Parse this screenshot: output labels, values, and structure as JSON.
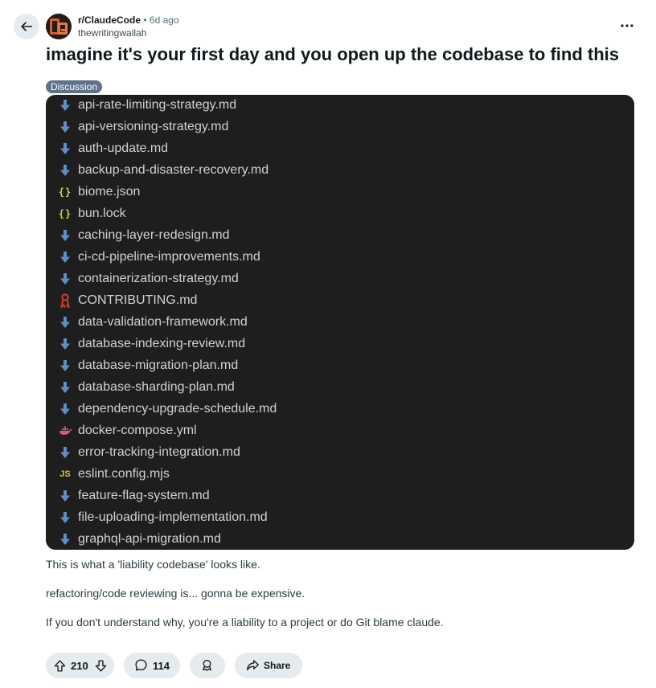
{
  "post": {
    "subreddit": "r/ClaudeCode",
    "separator": "•",
    "time_ago": "6d ago",
    "author": "thewritingwallah",
    "title": "imagine it's your first day and you open up the codebase to find this",
    "flair": "Discussion",
    "files": [
      {
        "name": "api-rate-limiting-strategy.md",
        "icon": "markdown-arrow-icon"
      },
      {
        "name": "api-versioning-strategy.md",
        "icon": "markdown-arrow-icon"
      },
      {
        "name": "auth-update.md",
        "icon": "markdown-arrow-icon"
      },
      {
        "name": "backup-and-disaster-recovery.md",
        "icon": "markdown-arrow-icon"
      },
      {
        "name": "biome.json",
        "icon": "json-braces-icon"
      },
      {
        "name": "bun.lock",
        "icon": "json-braces-icon"
      },
      {
        "name": "caching-layer-redesign.md",
        "icon": "markdown-arrow-icon"
      },
      {
        "name": "ci-cd-pipeline-improvements.md",
        "icon": "markdown-arrow-icon"
      },
      {
        "name": "containerization-strategy.md",
        "icon": "markdown-arrow-icon"
      },
      {
        "name": "CONTRIBUTING.md",
        "icon": "contributing-ribbon-icon"
      },
      {
        "name": "data-validation-framework.md",
        "icon": "markdown-arrow-icon"
      },
      {
        "name": "database-indexing-review.md",
        "icon": "markdown-arrow-icon"
      },
      {
        "name": "database-migration-plan.md",
        "icon": "markdown-arrow-icon"
      },
      {
        "name": "database-sharding-plan.md",
        "icon": "markdown-arrow-icon"
      },
      {
        "name": "dependency-upgrade-schedule.md",
        "icon": "markdown-arrow-icon"
      },
      {
        "name": "docker-compose.yml",
        "icon": "docker-whale-icon"
      },
      {
        "name": "error-tracking-integration.md",
        "icon": "markdown-arrow-icon"
      },
      {
        "name": "eslint.config.mjs",
        "icon": "js-file-icon"
      },
      {
        "name": "feature-flag-system.md",
        "icon": "markdown-arrow-icon"
      },
      {
        "name": "file-uploading-implementation.md",
        "icon": "markdown-arrow-icon"
      },
      {
        "name": "graphql-api-migration.md",
        "icon": "markdown-arrow-icon"
      }
    ],
    "body": [
      "This is what a 'liability codebase' looks like.",
      "refactoring/code reviewing is... gonna be expensive.",
      "If you don't understand why, you're a liability to a project or do Git blame claude."
    ]
  },
  "actions": {
    "votes": "210",
    "comments": "114",
    "share_label": "Share"
  },
  "colors": {
    "code_bg": "#1e1e1f",
    "md_icon": "#5d8fc2",
    "json_icon": "#d7c94f",
    "js_icon": "#d8c54b",
    "docker_icon": "#d95a7a",
    "contributing_icon": "#c0392b",
    "flair_bg": "#5f7289"
  }
}
